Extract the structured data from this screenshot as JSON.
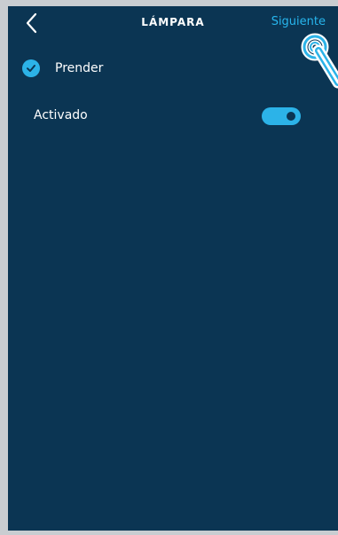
{
  "header": {
    "back_icon": "chevron-left-icon",
    "title": "LÁMPARA",
    "next_label": "Siguiente"
  },
  "option": {
    "label": "Prender",
    "checked": true
  },
  "toggle": {
    "label": "Activado",
    "on": true
  },
  "colors": {
    "background": "#0b3553",
    "accent": "#2cb3e8",
    "text": "#ffffff"
  }
}
